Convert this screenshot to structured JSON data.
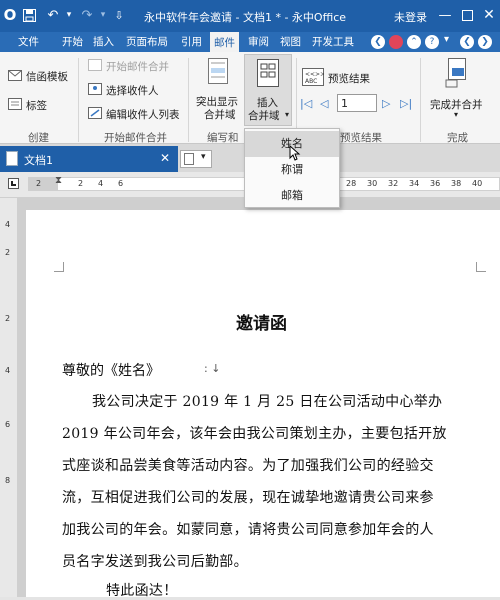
{
  "titlebar": {
    "app_logo": "O",
    "title": "永中软件年会邀请 - 文档1 * - 永中Office",
    "login": "未登录"
  },
  "menu": {
    "items": [
      "文件",
      "开始",
      "插入",
      "页面布局",
      "引用",
      "邮件",
      "审阅",
      "视图",
      "开发工具"
    ],
    "active": "邮件"
  },
  "ribbon": {
    "envelope_template": "信函模板",
    "label": "标签",
    "group_create": "创建",
    "start_merge": "开始邮件合并",
    "select_recipients": "选择收件人",
    "edit_recipients": "编辑收件人列表",
    "group_start_merge": "开始邮件合并",
    "highlight_fields": "突出显示\n合并域",
    "highlight_line1": "突出显示",
    "highlight_line2": "合并域",
    "insert_field_line1": "插入",
    "insert_field_line2": "合并域",
    "group_write_insert": "编写和",
    "preview_results": "预览结果",
    "record_number": "1",
    "group_preview": "预览结果",
    "finish_merge": "完成并合并",
    "group_finish": "完成"
  },
  "dropdown": {
    "items": [
      "姓名",
      "称谓",
      "邮箱"
    ],
    "highlighted": "姓名"
  },
  "doctab": {
    "name": "文档1"
  },
  "ruler": {
    "ticks": [
      "2",
      "2",
      "4",
      "6",
      "28",
      "30",
      "32",
      "34",
      "36",
      "38",
      "40"
    ]
  },
  "vruler": {
    "ticks": [
      "4",
      "2",
      "2",
      "4",
      "6",
      "8"
    ]
  },
  "document": {
    "title": "邀请函",
    "greeting": "尊敬的《姓名》",
    "body": [
      "我公司决定于 2019 年 1 月 25 日在公司活动中心举办",
      "2019 年公司年会，该年会由我公司策划主办，主要包括开放",
      "式座谈和品尝美食等活动内容。为了加强我们公司的经验交",
      "流，互相促进我们公司的发展，现在诚挚地邀请贵公司来参",
      "加我公司的年会。如蒙同意，请将贵公司同意参加年会的人",
      "员名字发送到我公司后勤部。"
    ],
    "closing": "特此函达！"
  },
  "colors": {
    "title_blue": "#1f5fa8",
    "menu_blue": "#2a6cb6",
    "ribbon_bg": "#f5f5f5",
    "doc_tab_active": "#1f5fa8"
  }
}
